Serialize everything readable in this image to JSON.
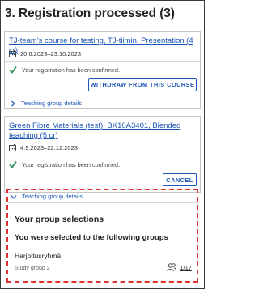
{
  "section": {
    "title": "3. Registration processed (3)"
  },
  "courses": [
    {
      "link": "TJ-team's course for testing, TJ-tiimin, Presentation (4 cr)",
      "dates": "20.6.2023–23.10.2023",
      "status": "Your registration has been confirmed.",
      "action_label": "WITHDRAW FROM THIS COURSE",
      "details_label": "Teaching group details"
    },
    {
      "link": "Green Fibre Materials (test), BK10A3401, Blended teaching (5 cr)",
      "dates": "4.9.2023–22.12.2023",
      "status": "Your registration has been confirmed.",
      "action_label": "CANCEL",
      "details_label": "Teaching group details"
    }
  ],
  "group_details": {
    "title": "Your group selections",
    "subtitle": "You were selected to the following groups",
    "group_name": "Harjoitusryhmä",
    "group_meta": "Study group 2",
    "seats": "1/17"
  },
  "colors": {
    "link": "#1b55b5",
    "confirm": "#2e8b57",
    "highlight": "#e03030"
  },
  "icons": [
    "calendar-icon",
    "check-icon",
    "chevron-right-icon",
    "chevron-down-icon",
    "people-icon"
  ]
}
